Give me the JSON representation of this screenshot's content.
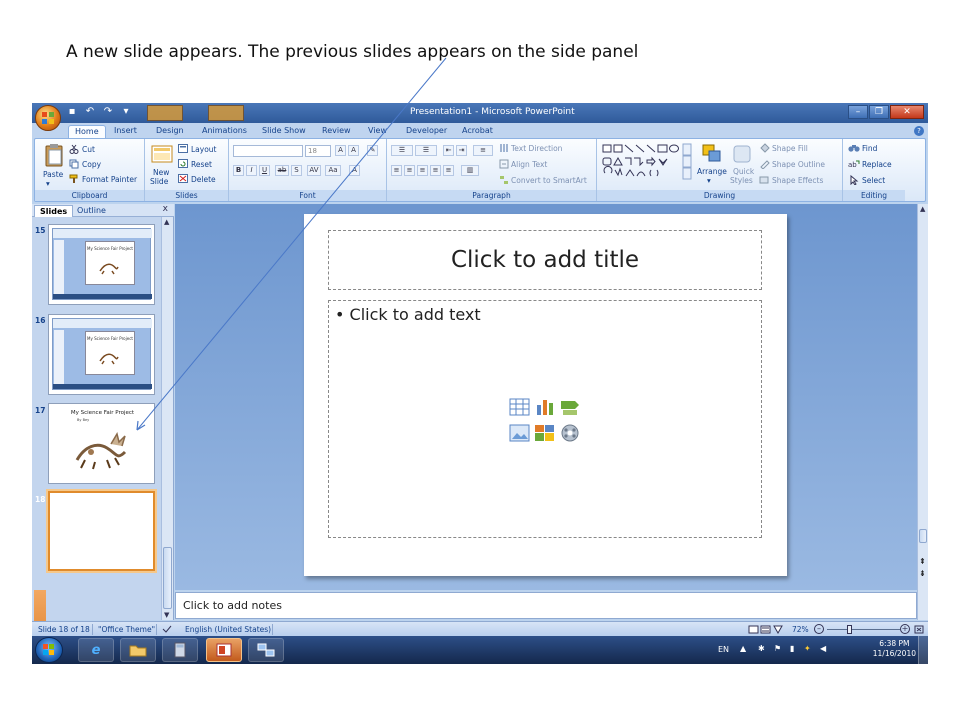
{
  "caption": "A new slide appears. The previous slides appears on the side panel",
  "window": {
    "title": "Presentation1 - Microsoft PowerPoint",
    "controls": {
      "minimize": "–",
      "restore": "❐",
      "close": "✕"
    }
  },
  "tabs": [
    "Home",
    "Insert",
    "Design",
    "Animations",
    "Slide Show",
    "Review",
    "View",
    "Developer",
    "Acrobat"
  ],
  "ribbon": {
    "clipboard": {
      "paste": "Paste",
      "cut": "Cut",
      "copy": "Copy",
      "format_painter": "Format Painter",
      "label": "Clipboard"
    },
    "slides": {
      "new_slide": "New",
      "new_slide2": "Slide",
      "layout": "Layout",
      "reset": "Reset",
      "delete": "Delete",
      "label": "Slides"
    },
    "font": {
      "size": "18",
      "label": "Font"
    },
    "paragraph": {
      "text_direction": "Text Direction",
      "align_text": "Align Text",
      "convert": "Convert to SmartArt",
      "label": "Paragraph"
    },
    "drawing": {
      "arrange": "Arrange",
      "quick": "Quick",
      "styles": "Styles",
      "shape_fill": "Shape Fill",
      "shape_outline": "Shape Outline",
      "shape_effects": "Shape Effects",
      "label": "Drawing"
    },
    "editing": {
      "find": "Find",
      "replace": "Replace",
      "select": "Select",
      "label": "Editing"
    }
  },
  "panel": {
    "tabs": [
      "Slides",
      "Outline"
    ],
    "close": "x",
    "thumbs": [
      {
        "num": "15",
        "title": "My Science Fair Project"
      },
      {
        "num": "16",
        "title": "My Science Fair Project"
      },
      {
        "num": "17",
        "title": "My Science Fair Project",
        "subtitle": "By Bey"
      },
      {
        "num": "18"
      }
    ]
  },
  "slide": {
    "title_placeholder": "Click to add title",
    "body_placeholder": "Click to add text",
    "bullet": "•"
  },
  "notes": "Click to add notes",
  "status": {
    "slide": "Slide 18 of 18",
    "theme": "\"Office Theme\"",
    "language": "English (United States)",
    "zoom": "72%"
  },
  "taskbar": {
    "lang": "EN",
    "time": "6:38 PM",
    "date": "11/16/2010"
  }
}
